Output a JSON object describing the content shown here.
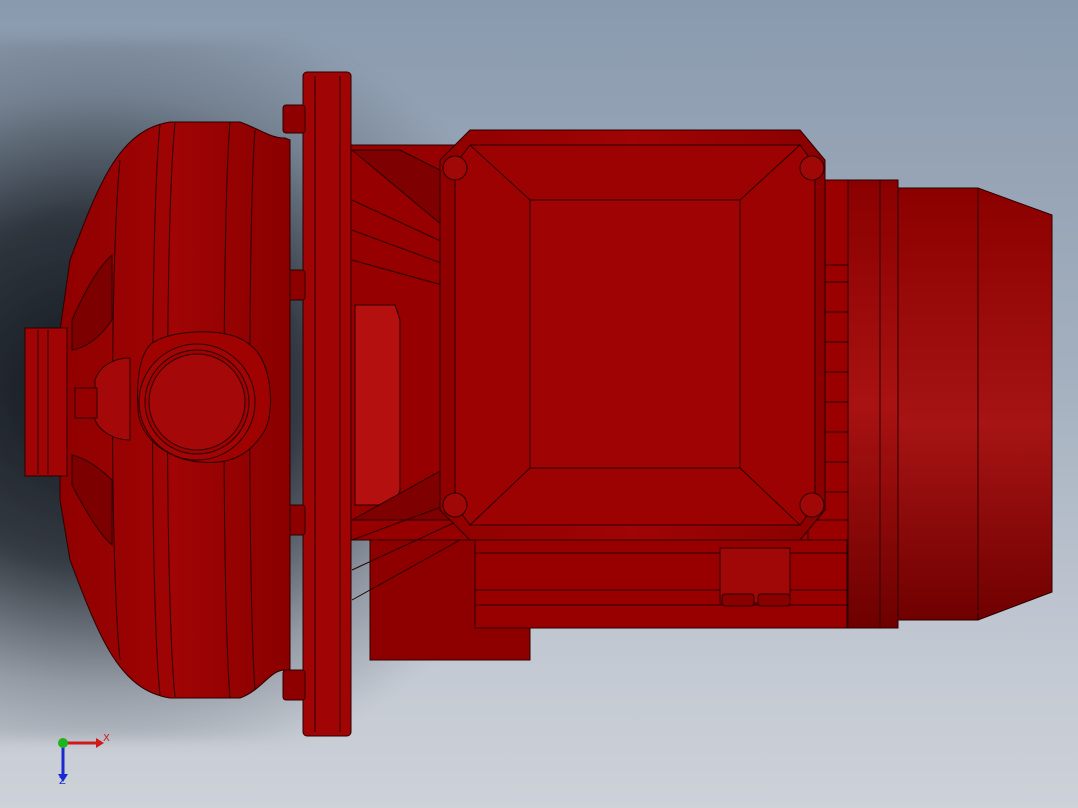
{
  "viewport": {
    "background_top": "#8a9aae",
    "background_bottom": "#cdd1d8"
  },
  "model": {
    "part_color": "#9e0000",
    "edge_color": "#2a0000",
    "highlight_color": "#c41010"
  },
  "triad": {
    "x_label": "X",
    "z_label": "Z",
    "x_color": "#d01a1a",
    "y_color": "#1db41d",
    "z_color": "#1a2ad0"
  }
}
